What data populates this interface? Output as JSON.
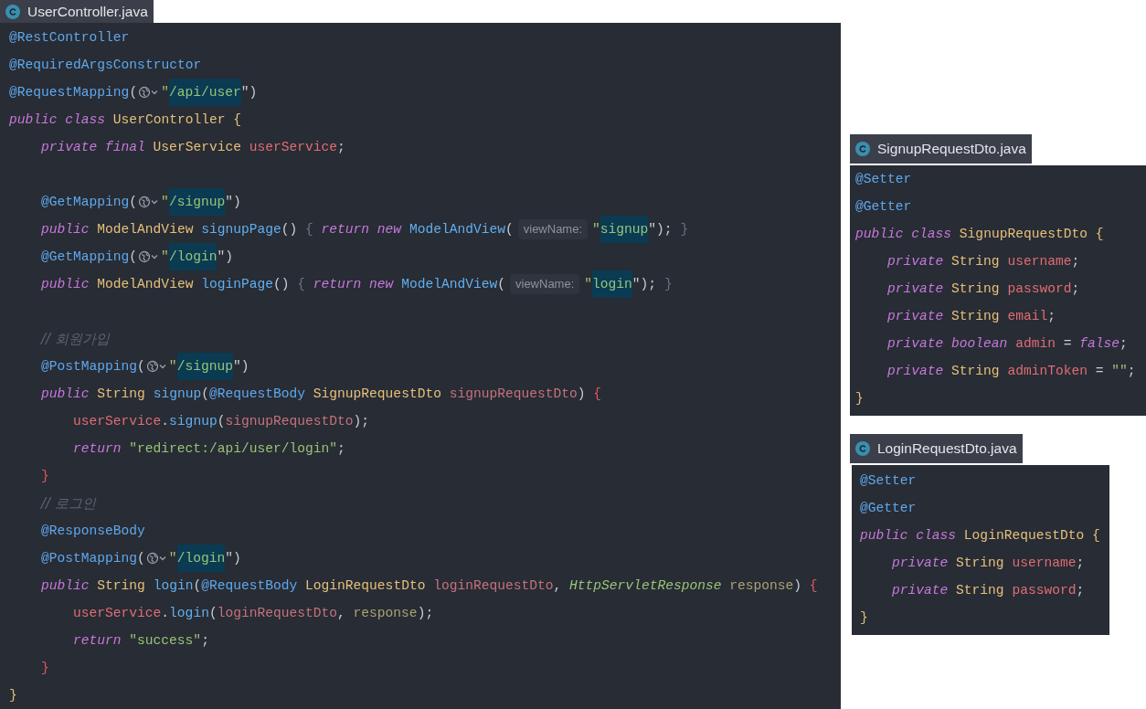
{
  "files": [
    {
      "tab": "UserController.java",
      "lines": [
        {
          "kind": "code",
          "tokens": [
            {
              "text": "@RestController",
              "kind": "ann"
            }
          ]
        },
        {
          "kind": "code",
          "tokens": [
            {
              "text": "@RequiredArgsConstructor",
              "kind": "ann"
            }
          ]
        },
        {
          "kind": "code",
          "tokens": [
            {
              "text": "@RequestMapping",
              "kind": "ann"
            },
            {
              "text": "(",
              "kind": "punct"
            },
            {
              "kind": "globe"
            },
            {
              "text": "\"",
              "kind": "str"
            },
            {
              "text": "/api/user",
              "kind": "str",
              "hl": true
            },
            {
              "text": "\")",
              "kind": "punct"
            }
          ]
        },
        {
          "kind": "code",
          "tokens": [
            {
              "text": "public class ",
              "kind": "kw"
            },
            {
              "text": "UserController ",
              "kind": "type"
            },
            {
              "text": "{",
              "kind": "brace-class"
            }
          ],
          "children": [
            {
              "kind": "code",
              "tokens": [
                {
                  "text": "private final ",
                  "kind": "kw"
                },
                {
                  "text": "UserService ",
                  "kind": "type"
                },
                {
                  "text": "userService",
                  "kind": "field"
                },
                {
                  "text": ";",
                  "kind": "punct"
                }
              ]
            },
            {
              "kind": "blank"
            },
            {
              "kind": "code",
              "tokens": [
                {
                  "text": "@GetMapping",
                  "kind": "ann"
                },
                {
                  "text": "(",
                  "kind": "punct"
                },
                {
                  "kind": "globe"
                },
                {
                  "text": "\"",
                  "kind": "str"
                },
                {
                  "text": "/signup",
                  "kind": "str",
                  "hl": true
                },
                {
                  "text": "\")",
                  "kind": "punct"
                }
              ]
            },
            {
              "kind": "code",
              "tokens": [
                {
                  "text": "public ",
                  "kind": "kw"
                },
                {
                  "text": "ModelAndView ",
                  "kind": "type"
                },
                {
                  "text": "signupPage",
                  "kind": "method"
                },
                {
                  "text": "() ",
                  "kind": "punct"
                },
                {
                  "text": "{ ",
                  "kind": "fold"
                },
                {
                  "text": "return new ",
                  "kind": "kw"
                },
                {
                  "text": "ModelAndView",
                  "kind": "method"
                },
                {
                  "text": "(",
                  "kind": "punct"
                },
                {
                  "text": "viewName:",
                  "kind": "hint"
                },
                {
                  "text": "\"",
                  "kind": "str"
                },
                {
                  "text": "signup",
                  "kind": "str",
                  "hl": true
                },
                {
                  "text": "\"); ",
                  "kind": "punct"
                },
                {
                  "text": "}",
                  "kind": "fold"
                }
              ]
            },
            {
              "kind": "code",
              "tokens": [
                {
                  "text": "@GetMapping",
                  "kind": "ann"
                },
                {
                  "text": "(",
                  "kind": "punct"
                },
                {
                  "kind": "globe"
                },
                {
                  "text": "\"",
                  "kind": "str"
                },
                {
                  "text": "/login",
                  "kind": "str",
                  "hl": true
                },
                {
                  "text": "\")",
                  "kind": "punct"
                }
              ]
            },
            {
              "kind": "code",
              "tokens": [
                {
                  "text": "public ",
                  "kind": "kw"
                },
                {
                  "text": "ModelAndView ",
                  "kind": "type"
                },
                {
                  "text": "loginPage",
                  "kind": "method"
                },
                {
                  "text": "() ",
                  "kind": "punct"
                },
                {
                  "text": "{ ",
                  "kind": "fold"
                },
                {
                  "text": "return new ",
                  "kind": "kw"
                },
                {
                  "text": "ModelAndView",
                  "kind": "method"
                },
                {
                  "text": "(",
                  "kind": "punct"
                },
                {
                  "text": "viewName:",
                  "kind": "hint"
                },
                {
                  "text": "\"",
                  "kind": "str"
                },
                {
                  "text": "login",
                  "kind": "str",
                  "hl": true
                },
                {
                  "text": "\"); ",
                  "kind": "punct"
                },
                {
                  "text": "}",
                  "kind": "fold"
                }
              ]
            },
            {
              "kind": "blank"
            },
            {
              "kind": "code",
              "tokens": [
                {
                  "text": "// 회원가입",
                  "kind": "comment"
                }
              ]
            },
            {
              "kind": "code",
              "tokens": [
                {
                  "text": "@PostMapping",
                  "kind": "ann"
                },
                {
                  "text": "(",
                  "kind": "punct"
                },
                {
                  "kind": "globe"
                },
                {
                  "text": "\"",
                  "kind": "str"
                },
                {
                  "text": "/signup",
                  "kind": "str",
                  "hl": true
                },
                {
                  "text": "\")",
                  "kind": "punct"
                }
              ]
            },
            {
              "kind": "code",
              "tokens": [
                {
                  "text": "public ",
                  "kind": "kw"
                },
                {
                  "text": "String ",
                  "kind": "type"
                },
                {
                  "text": "signup",
                  "kind": "method"
                },
                {
                  "text": "(",
                  "kind": "punct"
                },
                {
                  "text": "@RequestBody ",
                  "kind": "ann"
                },
                {
                  "text": "SignupRequestDto ",
                  "kind": "type"
                },
                {
                  "text": "signupRequestDto",
                  "kind": "param"
                },
                {
                  "text": ") ",
                  "kind": "punct"
                },
                {
                  "text": "{",
                  "kind": "brace-method"
                }
              ],
              "children": [
                {
                  "kind": "code",
                  "tokens": [
                    {
                      "text": "userService",
                      "kind": "field"
                    },
                    {
                      "text": ".",
                      "kind": "punct"
                    },
                    {
                      "text": "signup",
                      "kind": "method"
                    },
                    {
                      "text": "(",
                      "kind": "punct"
                    },
                    {
                      "text": "signupRequestDto",
                      "kind": "param"
                    },
                    {
                      "text": ");",
                      "kind": "punct"
                    }
                  ]
                },
                {
                  "kind": "code",
                  "tokens": [
                    {
                      "text": "return ",
                      "kind": "kw"
                    },
                    {
                      "text": "\"redirect:/api/user/login\"",
                      "kind": "str"
                    },
                    {
                      "text": ";",
                      "kind": "punct"
                    }
                  ]
                }
              ]
            },
            {
              "kind": "code",
              "tokens": [
                {
                  "text": "}",
                  "kind": "brace-method"
                }
              ]
            },
            {
              "kind": "code",
              "tokens": [
                {
                  "text": "// 로그인",
                  "kind": "comment"
                }
              ]
            },
            {
              "kind": "code",
              "tokens": [
                {
                  "text": "@ResponseBody",
                  "kind": "ann"
                }
              ]
            },
            {
              "kind": "code",
              "tokens": [
                {
                  "text": "@PostMapping",
                  "kind": "ann"
                },
                {
                  "text": "(",
                  "kind": "punct"
                },
                {
                  "kind": "globe"
                },
                {
                  "text": "\"",
                  "kind": "str"
                },
                {
                  "text": "/login",
                  "kind": "str",
                  "hl": true
                },
                {
                  "text": "\")",
                  "kind": "punct"
                }
              ]
            },
            {
              "kind": "code",
              "tokens": [
                {
                  "text": "public ",
                  "kind": "kw"
                },
                {
                  "text": "String ",
                  "kind": "type"
                },
                {
                  "text": "login",
                  "kind": "method"
                },
                {
                  "text": "(",
                  "kind": "punct"
                },
                {
                  "text": "@RequestBody ",
                  "kind": "ann"
                },
                {
                  "text": "LoginRequestDto ",
                  "kind": "type"
                },
                {
                  "text": "loginRequestDto",
                  "kind": "param"
                },
                {
                  "text": ", ",
                  "kind": "punct"
                },
                {
                  "text": "HttpServletResponse ",
                  "kind": "itype"
                },
                {
                  "text": "response",
                  "kind": "local"
                },
                {
                  "text": ") ",
                  "kind": "punct"
                },
                {
                  "text": "{",
                  "kind": "brace-method"
                }
              ],
              "children": [
                {
                  "kind": "code",
                  "tokens": [
                    {
                      "text": "userService",
                      "kind": "field"
                    },
                    {
                      "text": ".",
                      "kind": "punct"
                    },
                    {
                      "text": "login",
                      "kind": "method"
                    },
                    {
                      "text": "(",
                      "kind": "punct"
                    },
                    {
                      "text": "loginRequestDto",
                      "kind": "param"
                    },
                    {
                      "text": ", ",
                      "kind": "punct"
                    },
                    {
                      "text": "response",
                      "kind": "local"
                    },
                    {
                      "text": ");",
                      "kind": "punct"
                    }
                  ]
                },
                {
                  "kind": "code",
                  "tokens": [
                    {
                      "text": "return ",
                      "kind": "kw"
                    },
                    {
                      "text": "\"success\"",
                      "kind": "str"
                    },
                    {
                      "text": ";",
                      "kind": "punct"
                    }
                  ]
                }
              ]
            },
            {
              "kind": "code",
              "tokens": [
                {
                  "text": "}",
                  "kind": "brace-method"
                }
              ]
            }
          ]
        },
        {
          "kind": "code",
          "tokens": [
            {
              "text": "}",
              "kind": "brace-class"
            }
          ]
        }
      ]
    },
    {
      "tab": "SignupRequestDto.java",
      "lines": [
        {
          "kind": "code",
          "tokens": [
            {
              "text": "@Setter",
              "kind": "ann"
            }
          ]
        },
        {
          "kind": "code",
          "tokens": [
            {
              "text": "@Getter",
              "kind": "ann"
            }
          ]
        },
        {
          "kind": "code",
          "tokens": [
            {
              "text": "public class ",
              "kind": "kw"
            },
            {
              "text": "SignupRequestDto ",
              "kind": "type"
            },
            {
              "text": "{",
              "kind": "brace-class"
            }
          ],
          "children": [
            {
              "kind": "code",
              "tokens": [
                {
                  "text": "private ",
                  "kind": "kw"
                },
                {
                  "text": "String ",
                  "kind": "type"
                },
                {
                  "text": "username",
                  "kind": "field"
                },
                {
                  "text": ";",
                  "kind": "punct"
                }
              ]
            },
            {
              "kind": "code",
              "tokens": [
                {
                  "text": "private ",
                  "kind": "kw"
                },
                {
                  "text": "String ",
                  "kind": "type"
                },
                {
                  "text": "password",
                  "kind": "field"
                },
                {
                  "text": ";",
                  "kind": "punct"
                }
              ]
            },
            {
              "kind": "code",
              "tokens": [
                {
                  "text": "private ",
                  "kind": "kw"
                },
                {
                  "text": "String ",
                  "kind": "type"
                },
                {
                  "text": "email",
                  "kind": "field"
                },
                {
                  "text": ";",
                  "kind": "punct"
                }
              ]
            },
            {
              "kind": "code",
              "tokens": [
                {
                  "text": "private ",
                  "kind": "kw"
                },
                {
                  "text": "boolean ",
                  "kind": "kw"
                },
                {
                  "text": "admin",
                  "kind": "field"
                },
                {
                  "text": " = ",
                  "kind": "punct"
                },
                {
                  "text": "false",
                  "kind": "kw"
                },
                {
                  "text": ";",
                  "kind": "punct"
                }
              ]
            },
            {
              "kind": "code",
              "tokens": [
                {
                  "text": "private ",
                  "kind": "kw"
                },
                {
                  "text": "String ",
                  "kind": "type"
                },
                {
                  "text": "adminToken",
                  "kind": "field"
                },
                {
                  "text": " = ",
                  "kind": "punct"
                },
                {
                  "text": "\"\"",
                  "kind": "str"
                },
                {
                  "text": ";",
                  "kind": "punct"
                }
              ]
            }
          ]
        },
        {
          "kind": "code",
          "tokens": [
            {
              "text": "}",
              "kind": "brace-class"
            }
          ]
        }
      ]
    },
    {
      "tab": "LoginRequestDto.java",
      "lines": [
        {
          "kind": "code",
          "tokens": [
            {
              "text": "@Setter",
              "kind": "ann"
            }
          ]
        },
        {
          "kind": "code",
          "tokens": [
            {
              "text": "@Getter",
              "kind": "ann"
            }
          ]
        },
        {
          "kind": "code",
          "tokens": [
            {
              "text": "public class ",
              "kind": "kw"
            },
            {
              "text": "LoginRequestDto ",
              "kind": "type"
            },
            {
              "text": "{",
              "kind": "brace-class"
            }
          ],
          "children": [
            {
              "kind": "code",
              "tokens": [
                {
                  "text": "private ",
                  "kind": "kw"
                },
                {
                  "text": "String ",
                  "kind": "type"
                },
                {
                  "text": "username",
                  "kind": "field"
                },
                {
                  "text": ";",
                  "kind": "punct"
                }
              ]
            },
            {
              "kind": "code",
              "tokens": [
                {
                  "text": "private ",
                  "kind": "kw"
                },
                {
                  "text": "String ",
                  "kind": "type"
                },
                {
                  "text": "password",
                  "kind": "field"
                },
                {
                  "text": ";",
                  "kind": "punct"
                }
              ]
            }
          ]
        },
        {
          "kind": "code",
          "tokens": [
            {
              "text": "}",
              "kind": "brace-class"
            }
          ]
        }
      ]
    }
  ]
}
